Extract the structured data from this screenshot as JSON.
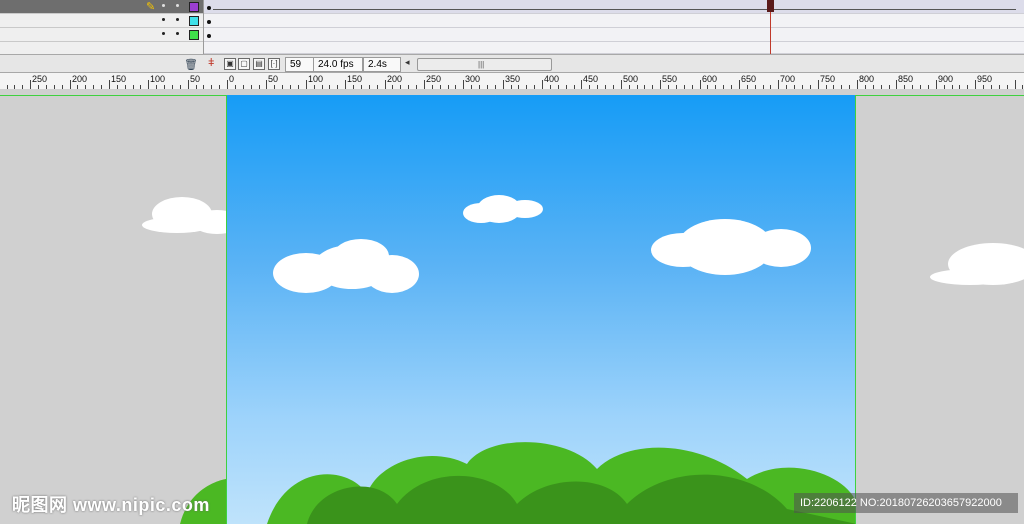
{
  "status_bar": {
    "current_frame": "59",
    "frame_rate": "24.0 fps",
    "elapsed_time": "2.4s"
  },
  "ruler": {
    "labels": [
      "250",
      "200",
      "150",
      "100",
      "50",
      "0",
      "50",
      "100",
      "150",
      "200",
      "250",
      "300",
      "350",
      "400",
      "450",
      "500",
      "550",
      "600",
      "650",
      "700",
      "750",
      "800",
      "850",
      "900",
      "950"
    ]
  },
  "layers": [
    {
      "selected": true,
      "outline_color": "#9b3fd1"
    },
    {
      "selected": false,
      "outline_color": "#3fe0e8"
    },
    {
      "selected": false,
      "outline_color": "#3fe04a"
    }
  ],
  "colors": {
    "sky_top": "#169cf6",
    "sky_bottom": "#bfe3fb",
    "bush_light": "#4bb823",
    "bush_dark": "#3a931b",
    "stage_guide": "#3fd13f",
    "pasteboard": "#d0d0d0"
  },
  "watermark": {
    "site": "昵图网 www.nipic.com",
    "id_text": "ID:2206122 NO:20180726203657922000"
  }
}
